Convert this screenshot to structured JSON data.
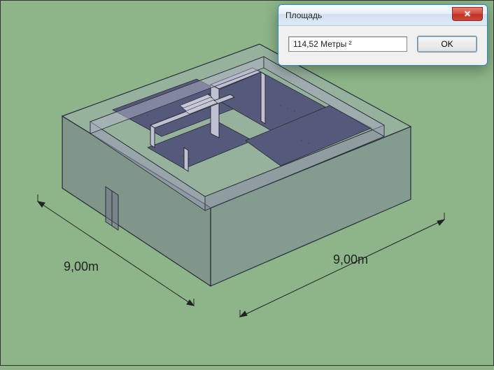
{
  "dialog": {
    "title": "Площадь",
    "value": "114,52 Метры ²",
    "ok_label": "OK"
  },
  "dimensions": {
    "left": "9,00m",
    "right": "9,00m"
  },
  "model": {
    "fill_light": "#a8abbf",
    "fill_dark": "#6f728a",
    "floor_fill": "#7a7e96",
    "edge": "#2a2c38",
    "dim_line": "#222222"
  }
}
